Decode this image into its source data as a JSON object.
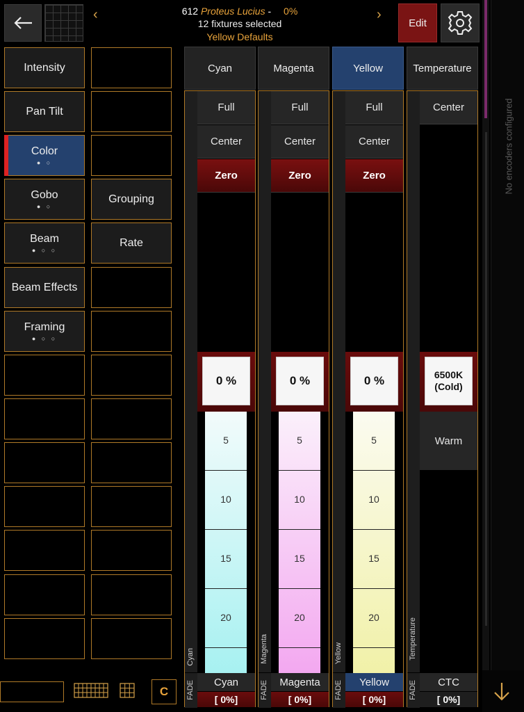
{
  "header": {
    "fixture_number": "612",
    "fixture_name": "Proteus Lucius",
    "separator": "-",
    "fixture_percent": "0%",
    "selection_text": "12 fixtures selected",
    "preset_text": "Yellow Defaults",
    "edit_label": "Edit",
    "prev_arrow": "‹",
    "next_arrow": "›"
  },
  "side_panel": {
    "message": "No encoders configured"
  },
  "categories_left": [
    {
      "label": "Intensity",
      "dots": ""
    },
    {
      "label": "Pan Tilt",
      "dots": ""
    },
    {
      "label": "Color",
      "dots": "● ○",
      "active": true
    },
    {
      "label": "Gobo",
      "dots": "● ○"
    },
    {
      "label": "Beam",
      "dots": "● ○ ○"
    },
    {
      "label": "Beam Effects",
      "dots": ""
    },
    {
      "label": "Framing",
      "dots": "● ○ ○"
    }
  ],
  "categories_right": [
    {
      "label": ""
    },
    {
      "label": ""
    },
    {
      "label": ""
    },
    {
      "label": "Grouping"
    },
    {
      "label": "Rate"
    }
  ],
  "columns": [
    {
      "name": "Cyan",
      "buttons": [
        "Full",
        "Center"
      ],
      "zero_label": "Zero",
      "value": "0 %",
      "ticks": [
        "5",
        "10",
        "15",
        "20"
      ],
      "vertical_label": "Cyan",
      "fade_label": "FADE",
      "footer_name": "Cyan",
      "footer_value": "[ 0%]",
      "gradient_top": "#f2fbfb",
      "gradient_bottom": "#a7f1f1",
      "level_percent": 0
    },
    {
      "name": "Magenta",
      "buttons": [
        "Full",
        "Center"
      ],
      "zero_label": "Zero",
      "value": "0 %",
      "ticks": [
        "5",
        "10",
        "15",
        "20"
      ],
      "vertical_label": "Magenta",
      "fade_label": "FADE",
      "footer_name": "Magenta",
      "footer_value": "[ 0%]",
      "gradient_top": "#fbf0fb",
      "gradient_bottom": "#f3a8f0",
      "level_percent": 0
    },
    {
      "name": "Yellow",
      "buttons": [
        "Full",
        "Center"
      ],
      "zero_label": "Zero",
      "value": "0 %",
      "ticks": [
        "5",
        "10",
        "15",
        "20"
      ],
      "vertical_label": "Yellow",
      "fade_label": "FADE",
      "footer_name": "Yellow",
      "footer_value": "[ 0%]",
      "gradient_top": "#fbfbf0",
      "gradient_bottom": "#f1f1a8",
      "level_percent": 0,
      "selected": true
    },
    {
      "name": "Temperature",
      "buttons": [
        "Center"
      ],
      "value_line1": "6500K",
      "value_line2": "(Cold)",
      "warm_label": "Warm",
      "vertical_label": "Temperature",
      "fade_label": "FADE",
      "footer_name": "CTC",
      "footer_value": "[ 0%]"
    }
  ],
  "bottom_bar": {
    "c_label": "C"
  },
  "colors": {
    "accent_orange": "#e8a33b",
    "selected_blue": "#24416e",
    "zero_red": "#7a1010",
    "border_orange": "#b07a28"
  }
}
